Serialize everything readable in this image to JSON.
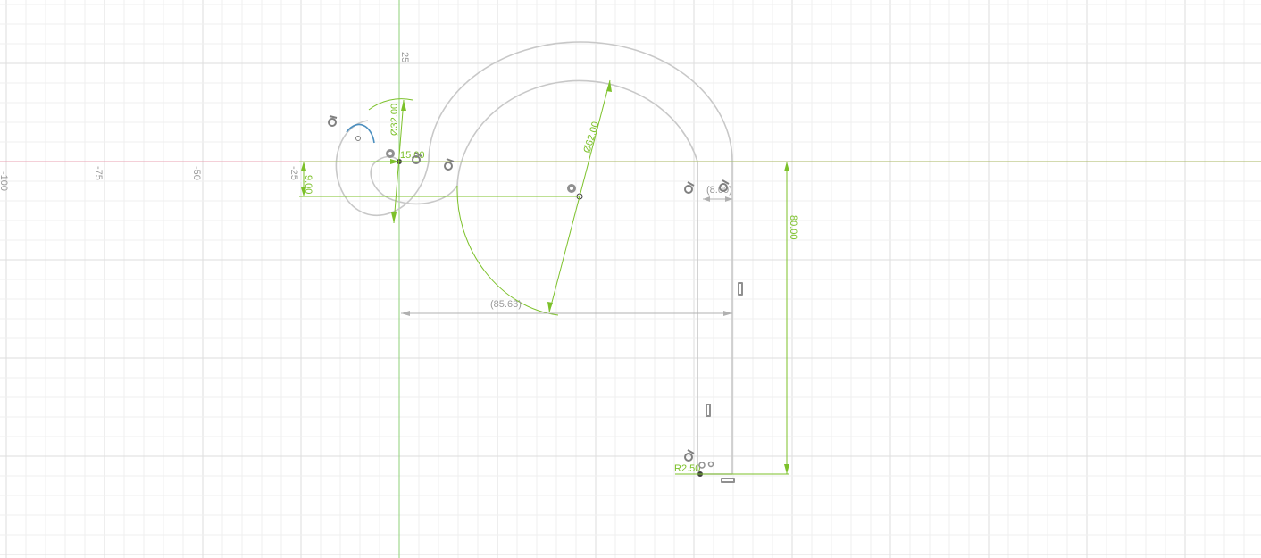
{
  "workspace": {
    "colors": {
      "background": "#ffffff",
      "grid_minor": "#efefef",
      "grid_major": "#dedede",
      "x_axis": "#e8a0b0",
      "y_axis": "#8fd07a",
      "geometry": "#c8c8c8",
      "selected_curve": "#4c8fbf",
      "dimension": "#7cc12a"
    }
  },
  "axis_labels": {
    "x_neg100": "-100",
    "x_neg75": "-75",
    "x_neg50": "-50",
    "x_neg25": "-25",
    "y_25": "25"
  },
  "dimensions": {
    "dia_32": "Ø32.00",
    "dia_62": "Ø62.00",
    "small_15": "15.00",
    "vert_9": "9.00",
    "vert_80": "80.00",
    "radius_2_5": "R2.50",
    "ref_85_63": "(85.63)",
    "ref_8": "(8.00)"
  },
  "constraint_icons": [
    "coincident-icon",
    "tangent-icon",
    "parallel-icon",
    "horizontal-icon"
  ]
}
